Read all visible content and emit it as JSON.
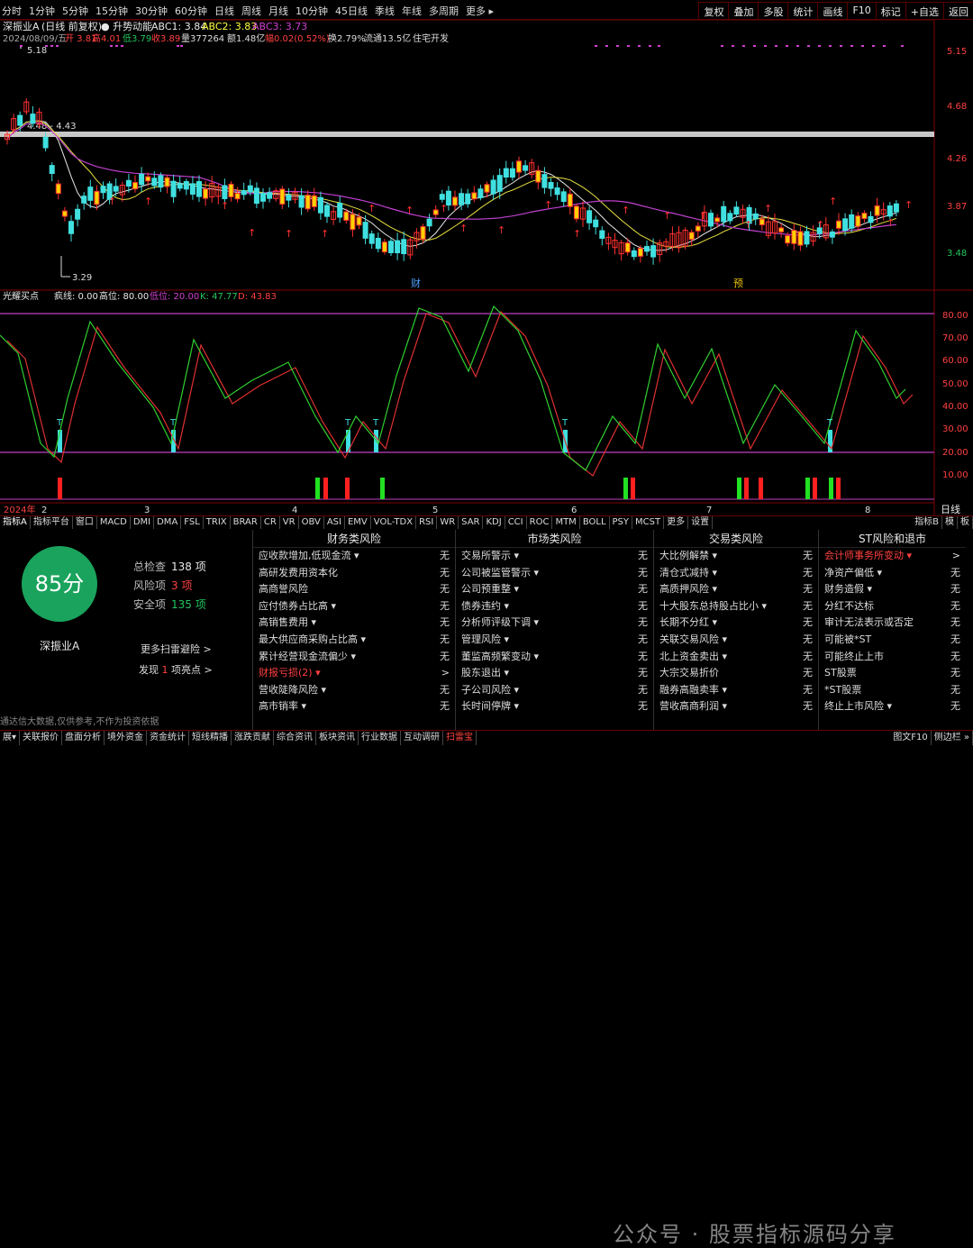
{
  "topbar": {
    "left": [
      "分时",
      "1分钟",
      "5分钟",
      "15分钟",
      "30分钟",
      "60分钟",
      "日线",
      "周线",
      "月线",
      "10分钟",
      "45日线",
      "季线",
      "年线",
      "多周期",
      "更多 ▸"
    ],
    "right": [
      "复权",
      "叠加",
      "多股",
      "统计",
      "画线",
      "F10",
      "标记",
      "+自选",
      "返回"
    ]
  },
  "chart_header": {
    "title": "深振业A",
    "sub": "(日线 前复权)",
    "ind": "● 升势动能",
    "abc1": "ABC1: 3.84",
    "abc2": "ABC2: 3.83",
    "abc3": "ABC3: 3.73"
  },
  "quote_line": {
    "date": "2024/08/09/五",
    "open": "开 3.81",
    "high": "高4.01",
    "low": "低3.79",
    "close": "收3.89",
    "vol": "量377264",
    "amt": "额1.48亿",
    "chg": "幅0.02(0.52%)",
    "turn": "换2.79%",
    "float": "流通13.5亿",
    "sector": "住宅开发"
  },
  "price_axis": [
    "5.15",
    "4.68",
    "4.26",
    "3.87",
    "3.48"
  ],
  "price_labels": {
    "high": "5.18",
    "low": "3.29",
    "band": "4.48 - 4.43"
  },
  "event_labels": [
    "财",
    "预"
  ],
  "indicator_header": {
    "name": "光耀买点",
    "a": "疯线: 0.00",
    "b": "高位: 80.00",
    "c": "低位: 20.00",
    "k": "K: 47.77",
    "d": "D: 43.83"
  },
  "ind_axis": [
    "80.00",
    "70.00",
    "60.00",
    "50.00",
    "40.00",
    "30.00",
    "20.00",
    "10.00"
  ],
  "month_labels": [
    "2024年",
    "2",
    "3",
    "4",
    "5",
    "6",
    "7",
    "8"
  ],
  "axis_right_label": "日线",
  "tabs": [
    "指标A",
    "指标平台",
    "窗口",
    "MACD",
    "DMI",
    "DMA",
    "FSL",
    "TRIX",
    "BRAR",
    "CR",
    "VR",
    "OBV",
    "ASI",
    "EMV",
    "VOL-TDX",
    "RSI",
    "WR",
    "SAR",
    "KDJ",
    "CCI",
    "ROC",
    "MTM",
    "BOLL",
    "PSY",
    "MCST",
    "更多",
    "设置"
  ],
  "tabs_right": [
    "指标B",
    "模",
    "板"
  ],
  "score": {
    "value": "85分",
    "company": "深振业A",
    "total_label": "总检查",
    "total": "138 项",
    "risk_label": "风险项",
    "risk": "3 项",
    "safe_label": "安全项",
    "safe": "135 项",
    "more": "更多扫雷避险 >",
    "find_pre": "发现",
    "find_num": "1",
    "find_post": "项亮点 >",
    "disclaimer": "通达信大数据,仅供参考,不作为投资依据"
  },
  "columns": [
    {
      "title": "财务类风险",
      "rows": [
        [
          "应收款增加,低现金流 ▾",
          "无"
        ],
        [
          "高研发费用资本化",
          "无"
        ],
        [
          "高商誉风险",
          "无"
        ],
        [
          "应付债券占比高 ▾",
          "无"
        ],
        [
          "高销售费用 ▾",
          "无"
        ],
        [
          "最大供应商采购占比高 ▾",
          "无"
        ],
        [
          "累计经营现金流偏少 ▾",
          "无"
        ],
        [
          "财报亏损(2) ▾",
          ">"
        ],
        [
          "营收陡降风险 ▾",
          "无"
        ],
        [
          "高市销率 ▾",
          "无"
        ]
      ]
    },
    {
      "title": "市场类风险",
      "rows": [
        [
          "交易所警示 ▾",
          "无"
        ],
        [
          "公司被监管警示 ▾",
          "无"
        ],
        [
          "公司预重整 ▾",
          "无"
        ],
        [
          "债券违约 ▾",
          "无"
        ],
        [
          "分析师评级下调 ▾",
          "无"
        ],
        [
          "管理风险 ▾",
          "无"
        ],
        [
          "董监高频繁变动 ▾",
          "无"
        ],
        [
          "股东退出 ▾",
          "无"
        ],
        [
          "子公司风险 ▾",
          "无"
        ],
        [
          "长时间停牌 ▾",
          "无"
        ]
      ]
    },
    {
      "title": "交易类风险",
      "rows": [
        [
          "大比例解禁 ▾",
          "无"
        ],
        [
          "清仓式减持 ▾",
          "无"
        ],
        [
          "高质押风险 ▾",
          "无"
        ],
        [
          "十大股东总持股占比小 ▾",
          "无"
        ],
        [
          "长期不分红 ▾",
          "无"
        ],
        [
          "关联交易风险 ▾",
          "无"
        ],
        [
          "北上资金卖出 ▾",
          "无"
        ],
        [
          "大宗交易折价",
          "无"
        ],
        [
          "融券高融卖率 ▾",
          "无"
        ],
        [
          "营收高商利润 ▾",
          "无"
        ]
      ]
    },
    {
      "title": "ST风险和退市",
      "rows": [
        [
          "会计师事务所变动 ▾",
          ">"
        ],
        [
          "净资产偏低 ▾",
          "无"
        ],
        [
          "财务造假 ▾",
          "无"
        ],
        [
          "分红不达标",
          "无"
        ],
        [
          "审计无法表示或否定",
          "无"
        ],
        [
          "可能被*ST",
          "无"
        ],
        [
          "可能终止上市",
          "无"
        ],
        [
          "ST股票",
          "无"
        ],
        [
          "*ST股票",
          "无"
        ],
        [
          "终止上市风险 ▾",
          "无"
        ]
      ]
    }
  ],
  "bottombar": [
    "展▾",
    "关联报价",
    "盘面分析",
    "境外资金",
    "资金统计",
    "短线精播",
    "涨跌贡献",
    "综合资讯",
    "板块资讯",
    "行业数据",
    "互动调研",
    "扫雷宝"
  ],
  "bottombar_right": [
    "图文F10",
    "侧边栏 »"
  ],
  "watermark": "公众号 · 股票指标源码分享",
  "chart_data": {
    "type": "candlestick",
    "price_range": [
      3.29,
      5.18
    ],
    "indicator_range": [
      0,
      90
    ],
    "levels": [
      80,
      20
    ]
  }
}
